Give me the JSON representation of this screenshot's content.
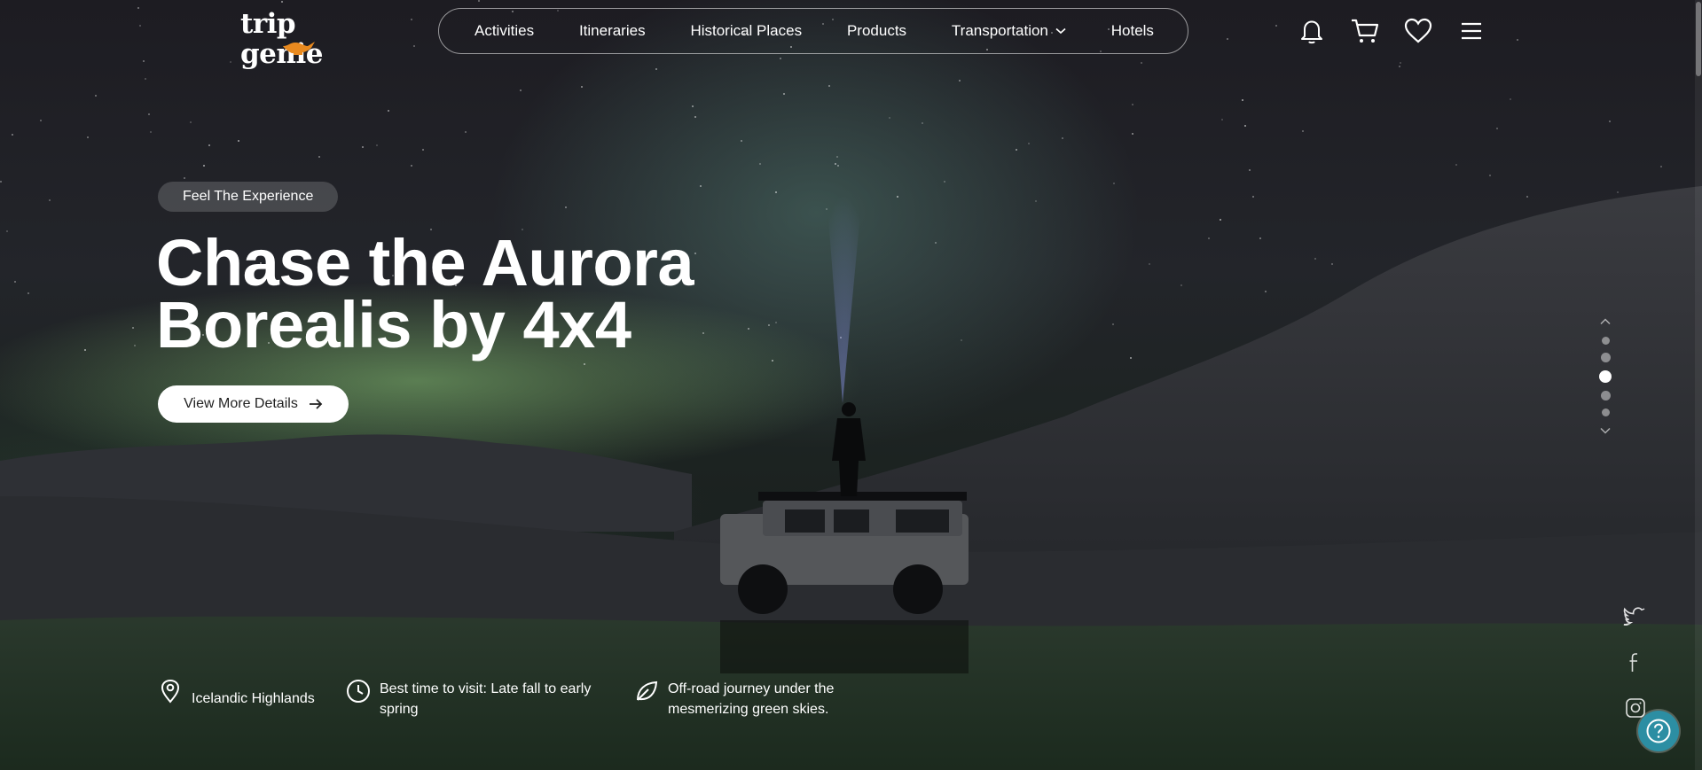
{
  "brand": {
    "logo_text": "trip genie"
  },
  "nav": {
    "items": [
      {
        "label": "Activities"
      },
      {
        "label": "Itineraries"
      },
      {
        "label": "Historical Places"
      },
      {
        "label": "Products"
      },
      {
        "label": "Transportation",
        "has_dropdown": true
      },
      {
        "label": "Hotels"
      }
    ]
  },
  "header_icons": [
    "bell-icon",
    "cart-icon",
    "heart-icon",
    "menu-icon"
  ],
  "hero": {
    "badge": "Feel The Experience",
    "title_line1": "Chase the Aurora",
    "title_line2": "Borealis by 4x4",
    "cta_label": "View More Details"
  },
  "slider": {
    "total": 5,
    "active_index": 2
  },
  "info": {
    "location": "Icelandic Highlands",
    "best_time_line1": "Best time to visit: Late fall to early",
    "best_time_line2": "spring",
    "description_line1": "Off-road journey under the",
    "description_line2": "mesmerizing green skies."
  },
  "socials": [
    "twitter-icon",
    "facebook-icon",
    "instagram-icon"
  ],
  "colors": {
    "accent": "#e98a1f",
    "help_button": "#2c8ea3",
    "cta_bg": "#ffffff"
  }
}
